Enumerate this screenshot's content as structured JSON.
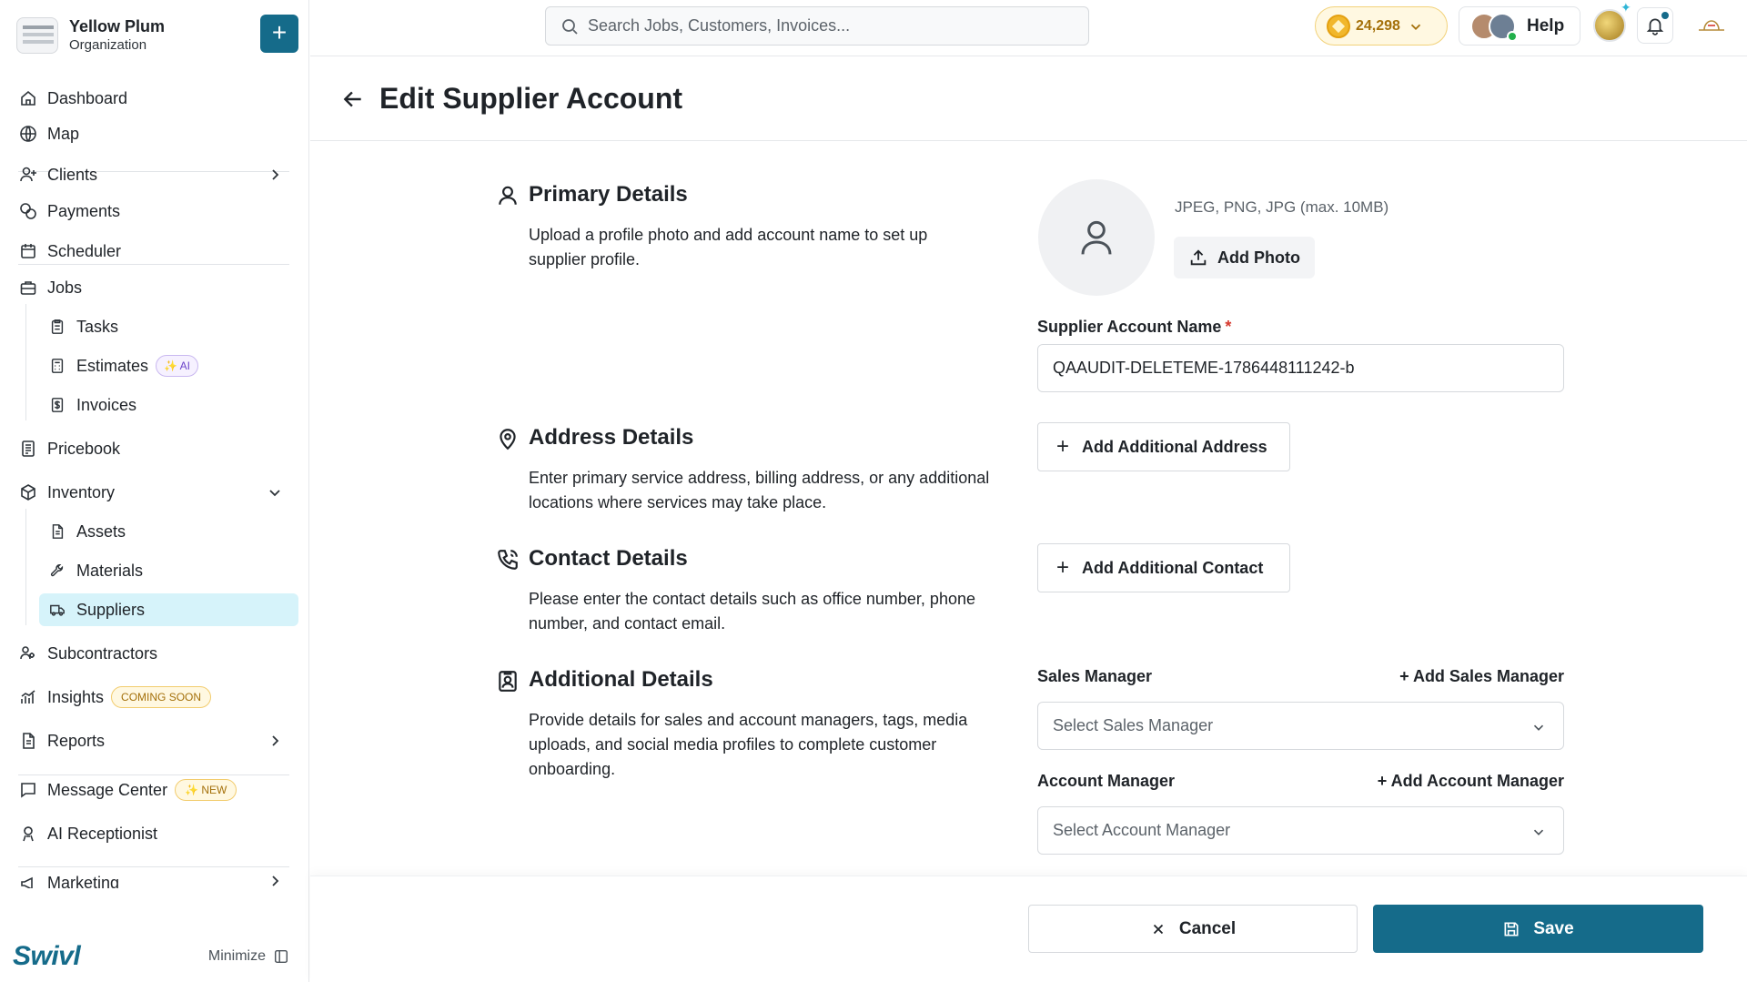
{
  "organization": {
    "name": "Yellow Plum",
    "subtitle": "Organization",
    "add_label": "+"
  },
  "sidebar": {
    "items": [
      {
        "label": "Dashboard",
        "icon": "home-icon"
      },
      {
        "label": "Map",
        "icon": "globe-icon"
      },
      {
        "label": "Clients",
        "icon": "user-plus-icon"
      },
      {
        "label": "Payments",
        "icon": "coins-icon"
      },
      {
        "label": "Scheduler",
        "icon": "calendar-icon"
      },
      {
        "label": "Jobs",
        "icon": "briefcase-icon"
      },
      {
        "label": "Tasks",
        "icon": "clipboard-icon"
      },
      {
        "label": "Estimates",
        "icon": "calculator-icon",
        "badge": "AI"
      },
      {
        "label": "Invoices",
        "icon": "invoice-icon"
      },
      {
        "label": "Pricebook",
        "icon": "book-icon"
      },
      {
        "label": "Inventory",
        "icon": "box-icon"
      },
      {
        "label": "Assets",
        "icon": "document-icon"
      },
      {
        "label": "Materials",
        "icon": "wrench-icon"
      },
      {
        "label": "Suppliers",
        "icon": "truck-icon"
      },
      {
        "label": "Subcontractors",
        "icon": "users-icon"
      },
      {
        "label": "Insights",
        "icon": "chart-icon",
        "badge": "COMING SOON"
      },
      {
        "label": "Reports",
        "icon": "report-icon"
      },
      {
        "label": "Message Center",
        "icon": "message-icon",
        "badge": "NEW"
      },
      {
        "label": "AI Receptionist",
        "icon": "receptionist-icon"
      },
      {
        "label": "Marketing",
        "icon": "megaphone-icon"
      }
    ],
    "brand": "Swivl",
    "minimize_label": "Minimize"
  },
  "topbar": {
    "search_placeholder": "Search Jobs, Customers, Invoices...",
    "coins": "24,298",
    "help_label": "Help"
  },
  "page": {
    "title": "Edit Supplier Account"
  },
  "sections": {
    "primary": {
      "title": "Primary Details",
      "description": "Upload a profile photo and add account name to set up supplier profile.",
      "photo_hint": "JPEG, PNG, JPG (max. 10MB)",
      "add_photo_label": "Add Photo",
      "name_label": "Supplier Account Name",
      "required_mark": "*",
      "name_value": "QAAUDIT-DELETEME-1786448111242-b"
    },
    "address": {
      "title": "Address Details",
      "description": "Enter primary service address, billing address, or any additional locations where services may take place.",
      "button_label": "Add Additional Address"
    },
    "contact": {
      "title": "Contact Details",
      "description": "Please enter the contact details such as office number, phone number, and contact email.",
      "button_label": "Add Additional Contact"
    },
    "additional": {
      "title": "Additional Details",
      "description": "Provide details for sales and account managers, tags, media uploads, and social media profiles to complete customer onboarding.",
      "sales_manager_label": "Sales Manager",
      "add_sales_manager": "+ Add Sales Manager",
      "sales_manager_placeholder": "Select Sales Manager",
      "account_manager_label": "Account Manager",
      "add_account_manager": "+ Add Account Manager",
      "account_manager_placeholder": "Select Account Manager"
    }
  },
  "footer": {
    "cancel_label": "Cancel",
    "save_label": "Save"
  },
  "colors": {
    "primary": "#156b8a",
    "active_nav": "#d6f3fa",
    "accent_gold": "#a4700a"
  }
}
